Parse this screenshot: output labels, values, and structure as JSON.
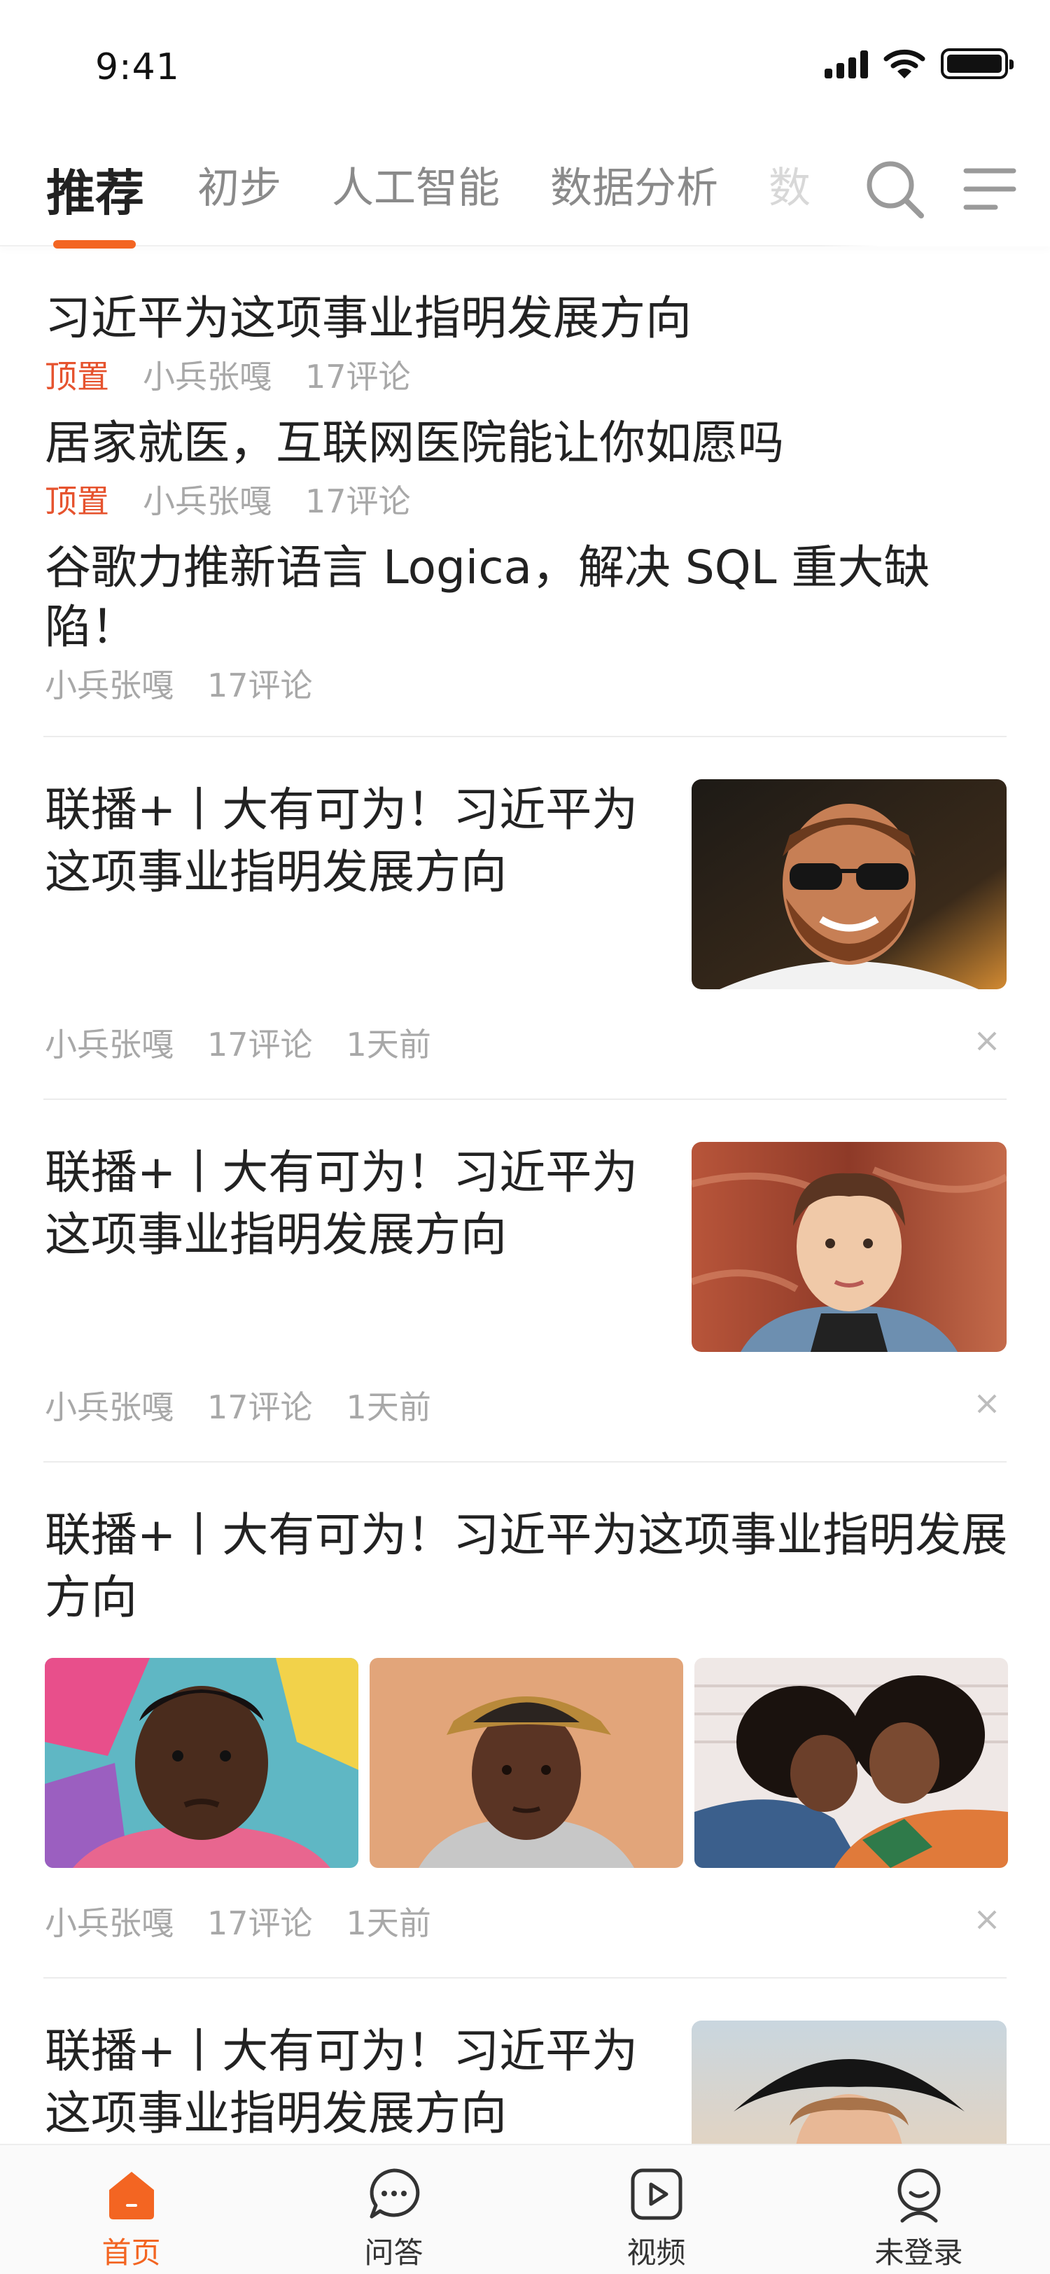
{
  "status_bar": {
    "time": "9:41"
  },
  "tabs": [
    {
      "label": "推荐",
      "active": true
    },
    {
      "label": "初步"
    },
    {
      "label": "人工智能"
    },
    {
      "label": "数据分析"
    },
    {
      "label": "数"
    }
  ],
  "pinned": [
    {
      "title": "习近平为这项事业指明发展方向",
      "tag": "顶置",
      "author": "小兵张嘎",
      "comments": "17评论"
    },
    {
      "title": "居家就医，互联网医院能让你如愿吗",
      "tag": "顶置",
      "author": "小兵张嘎",
      "comments": "17评论"
    },
    {
      "title": "谷歌力推新语言 Logica，解决 SQL 重大缺陷！",
      "author": "小兵张嘎",
      "comments": "17评论"
    }
  ],
  "cards": [
    {
      "title": "联播+丨大有可为！习近平为这项事业指明发展方向",
      "author": "小兵张嘎",
      "comments": "17评论",
      "time": "1天前"
    },
    {
      "title": "联播+丨大有可为！习近平为这项事业指明发展方向",
      "author": "小兵张嘎",
      "comments": "17评论",
      "time": "1天前"
    },
    {
      "title": "联播+丨大有可为！习近平为这项事业指明发展方向",
      "author": "小兵张嘎",
      "comments": "17评论",
      "time": "1天前"
    },
    {
      "title": "联播+丨大有可为！习近平为这项事业指明发展方向"
    }
  ],
  "bottom_nav": [
    {
      "label": "首页",
      "icon": "home-icon",
      "active": true
    },
    {
      "label": "问答",
      "icon": "chat-icon"
    },
    {
      "label": "视频",
      "icon": "video-play-icon"
    },
    {
      "label": "未登录",
      "icon": "user-icon"
    }
  ],
  "colors": {
    "accent": "#f36522",
    "pin_tag": "#e6532e",
    "meta_text": "#a8a8a8"
  }
}
